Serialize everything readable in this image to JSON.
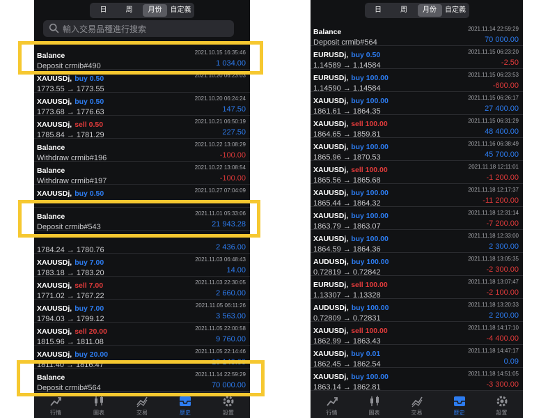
{
  "segments": [
    "日",
    "周",
    "月份",
    "自定義"
  ],
  "search_placeholder": "輸入交易品種進行搜索",
  "tabs": [
    "行情",
    "圖表",
    "交易",
    "歷史",
    "設置"
  ],
  "left": {
    "rows": [
      {
        "symbol": "Balance",
        "side": "",
        "sideType": "",
        "time": "2021.10.15 16:35:46",
        "desc": "Deposit crmib#490",
        "amount": "1 034.00",
        "amtType": "pos"
      },
      {
        "symbol": "XAUUSDj,",
        "side": "buy 0.50",
        "sideType": "buy",
        "time": "2021.10.20 06:23:03",
        "desc": "1773.55 → 1773.55",
        "amount": "",
        "amtType": "pos"
      },
      {
        "symbol": "XAUUSDj,",
        "side": "buy 0.50",
        "sideType": "buy",
        "time": "2021.10.20 06:24:24",
        "desc": "1773.68 → 1776.63",
        "amount": "147.50",
        "amtType": "pos"
      },
      {
        "symbol": "XAUUSDj,",
        "side": "sell 0.50",
        "sideType": "sell",
        "time": "2021.10.21 06:50:19",
        "desc": "1785.84 → 1781.29",
        "amount": "227.50",
        "amtType": "pos"
      },
      {
        "symbol": "Balance",
        "side": "",
        "sideType": "",
        "time": "2021.10.22 13:08:29",
        "desc": "Withdraw crmib#196",
        "amount": "-100.00",
        "amtType": "neg"
      },
      {
        "symbol": "Balance",
        "side": "",
        "sideType": "",
        "time": "2021.10.22 13:08:54",
        "desc": "Withdraw crmib#197",
        "amount": "-100.00",
        "amtType": "neg"
      },
      {
        "symbol": "XAUUSDj,",
        "side": "buy 0.50",
        "sideType": "buy",
        "time": "2021.10.27 07:04:09",
        "desc": "",
        "amount": "",
        "amtType": "pos"
      },
      {
        "symbol": "Balance",
        "side": "",
        "sideType": "",
        "time": "2021.11.01 05:33:06",
        "desc": "Deposit crmib#543",
        "amount": "21 943.28",
        "amtType": "pos"
      },
      {
        "symbol": "",
        "side": "",
        "sideType": "",
        "time": "",
        "desc": "1784.24 → 1780.76",
        "amount": "2 436.00",
        "amtType": "pos"
      },
      {
        "symbol": "XAUUSDj,",
        "side": "buy 7.00",
        "sideType": "buy",
        "time": "2021.11.03 06:48:43",
        "desc": "1783.18 → 1783.20",
        "amount": "14.00",
        "amtType": "pos"
      },
      {
        "symbol": "XAUUSDj,",
        "side": "sell 7.00",
        "sideType": "sell",
        "time": "2021.11.03 22:30:05",
        "desc": "1771.02 → 1767.22",
        "amount": "2 660.00",
        "amtType": "pos"
      },
      {
        "symbol": "XAUUSDj,",
        "side": "buy 7.00",
        "sideType": "buy",
        "time": "2021.11.05 06:11:26",
        "desc": "1794.03 → 1799.12",
        "amount": "3 563.00",
        "amtType": "pos"
      },
      {
        "symbol": "XAUUSDj,",
        "side": "sell 20.00",
        "sideType": "sell",
        "time": "2021.11.05 22:00:58",
        "desc": "1815.96 → 1811.08",
        "amount": "9 760.00",
        "amtType": "pos"
      },
      {
        "symbol": "XAUUSDj,",
        "side": "buy 20.00",
        "sideType": "buy",
        "time": "2021.11.05 22:14:46",
        "desc": "1811.40 → 1816.47",
        "amount": "10 140.00",
        "amtType": "pos"
      },
      {
        "symbol": "Balance",
        "side": "",
        "sideType": "",
        "time": "2021.11.14 22:59:29",
        "desc": "Deposit crmib#564",
        "amount": "70 000.00",
        "amtType": "pos"
      }
    ]
  },
  "right": {
    "rows": [
      {
        "symbol": "Balance",
        "side": "",
        "sideType": "",
        "time": "2021.11.14 22:59:29",
        "desc": "Deposit crmib#564",
        "amount": "70 000.00",
        "amtType": "pos"
      },
      {
        "symbol": "EURUSDj,",
        "side": "buy 0.50",
        "sideType": "buy",
        "time": "2021.11.15 06:23:20",
        "desc": "1.14589 → 1.14584",
        "amount": "-2.50",
        "amtType": "neg"
      },
      {
        "symbol": "EURUSDj,",
        "side": "buy 100.00",
        "sideType": "buy",
        "time": "2021.11.15 06:23:53",
        "desc": "1.14590 → 1.14584",
        "amount": "-600.00",
        "amtType": "neg"
      },
      {
        "symbol": "XAUUSDj,",
        "side": "buy 100.00",
        "sideType": "buy",
        "time": "2021.11.15 06:26:17",
        "desc": "1861.61 → 1864.35",
        "amount": "27 400.00",
        "amtType": "pos"
      },
      {
        "symbol": "XAUUSDj,",
        "side": "sell 100.00",
        "sideType": "sell",
        "time": "2021.11.15 06:31:29",
        "desc": "1864.65 → 1859.81",
        "amount": "48 400.00",
        "amtType": "pos"
      },
      {
        "symbol": "XAUUSDj,",
        "side": "buy 100.00",
        "sideType": "buy",
        "time": "2021.11.16 06:38:49",
        "desc": "1865.96 → 1870.53",
        "amount": "45 700.00",
        "amtType": "pos"
      },
      {
        "symbol": "XAUUSDj,",
        "side": "sell 100.00",
        "sideType": "sell",
        "time": "2021.11.18 12:11:01",
        "desc": "1865.56 → 1865.68",
        "amount": "-1 200.00",
        "amtType": "neg"
      },
      {
        "symbol": "XAUUSDj,",
        "side": "buy 100.00",
        "sideType": "buy",
        "time": "2021.11.18 12:17:37",
        "desc": "1865.44 → 1864.32",
        "amount": "-11 200.00",
        "amtType": "neg"
      },
      {
        "symbol": "XAUUSDj,",
        "side": "buy 100.00",
        "sideType": "buy",
        "time": "2021.11.18 12:31:14",
        "desc": "1863.79 → 1863.07",
        "amount": "-7 200.00",
        "amtType": "neg"
      },
      {
        "symbol": "XAUUSDj,",
        "side": "buy 100.00",
        "sideType": "buy",
        "time": "2021.11.18 12:33:00",
        "desc": "1864.59 → 1864.36",
        "amount": "2 300.00",
        "amtType": "pos"
      },
      {
        "symbol": "AUDUSDj,",
        "side": "buy 100.00",
        "sideType": "buy",
        "time": "2021.11.18 13:05:35",
        "desc": "0.72819 → 0.72842",
        "amount": "-2 300.00",
        "amtType": "neg"
      },
      {
        "symbol": "EURUSDj,",
        "side": "sell 100.00",
        "sideType": "sell",
        "time": "2021.11.18 13:07:47",
        "desc": "1.13307 → 1.13328",
        "amount": "-2 100.00",
        "amtType": "neg"
      },
      {
        "symbol": "AUDUSDj,",
        "side": "buy 100.00",
        "sideType": "buy",
        "time": "2021.11.18 13:20:33",
        "desc": "0.72809 → 0.72831",
        "amount": "2 200.00",
        "amtType": "pos"
      },
      {
        "symbol": "XAUUSDj,",
        "side": "sell 100.00",
        "sideType": "sell",
        "time": "2021.11.18 14:17:10",
        "desc": "1862.99 → 1863.43",
        "amount": "-4 400.00",
        "amtType": "neg"
      },
      {
        "symbol": "XAUUSDj,",
        "side": "buy 0.01",
        "sideType": "buy",
        "time": "2021.11.18 14:47:17",
        "desc": "1862.45 → 1862.54",
        "amount": "0.09",
        "amtType": "pos"
      },
      {
        "symbol": "XAUUSDj,",
        "side": "buy 100.00",
        "sideType": "buy",
        "time": "2021.11.18 14:51:05",
        "desc": "1863.14 → 1862.81",
        "amount": "-3 300.00",
        "amtType": "neg"
      }
    ]
  },
  "colors": {
    "background": "#111214",
    "buy": "#2d7cf0",
    "sell": "#e23b3b",
    "highlight": "#f6c830"
  },
  "icons": {
    "tabs": [
      "quotes-chart-icon",
      "candlestick-icon",
      "trade-icon",
      "history-inbox-icon",
      "gear-icon"
    ]
  }
}
